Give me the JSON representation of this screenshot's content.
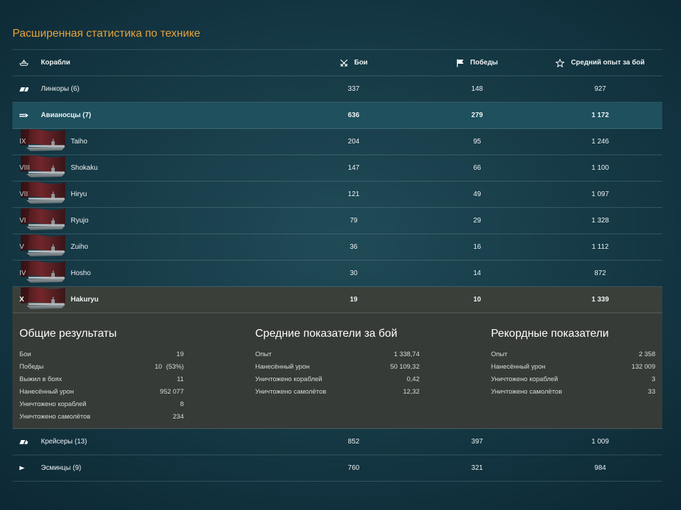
{
  "title": "Расширенная статистика по технике",
  "colors": {
    "title": "#e9a33b",
    "text": "#eef2f3",
    "expanded_class_row": "#1e505e",
    "selected_ship_row": "#3b3f3a",
    "details_panel": "#373b37"
  },
  "header": {
    "ships": {
      "label": "Корабли",
      "icon": "ship-icon"
    },
    "battles": {
      "label": "Бои",
      "icon": "crossed-swords-icon"
    },
    "wins": {
      "label": "Победы",
      "icon": "flag-icon"
    },
    "avg_xp": {
      "label": "Средний опыт за бой",
      "icon": "star-icon"
    }
  },
  "classes": [
    {
      "name": "Линкоры (6)",
      "icon": "battleship-icon",
      "battles": "337",
      "wins": "148",
      "avg_xp": "927"
    },
    {
      "name": "Авианосцы (7)",
      "icon": "aircraft-carrier-icon",
      "battles": "636",
      "wins": "279",
      "avg_xp": "1 172"
    },
    {
      "name": "Крейсеры (13)",
      "icon": "cruiser-icon",
      "battles": "852",
      "wins": "397",
      "avg_xp": "1 009"
    },
    {
      "name": "Эсминцы (9)",
      "icon": "destroyer-icon",
      "battles": "760",
      "wins": "321",
      "avg_xp": "984"
    }
  ],
  "carrier_ships": [
    {
      "tier": "IX",
      "name": "Taiho",
      "battles": "204",
      "wins": "95",
      "avg_xp": "1 246"
    },
    {
      "tier": "VIII",
      "name": "Shokaku",
      "battles": "147",
      "wins": "66",
      "avg_xp": "1 100"
    },
    {
      "tier": "VII",
      "name": "Hiryu",
      "battles": "121",
      "wins": "49",
      "avg_xp": "1 097"
    },
    {
      "tier": "VI",
      "name": "Ryujo",
      "battles": "79",
      "wins": "29",
      "avg_xp": "1 328"
    },
    {
      "tier": "V",
      "name": "Zuiho",
      "battles": "36",
      "wins": "16",
      "avg_xp": "1 112"
    },
    {
      "tier": "IV",
      "name": "Hosho",
      "battles": "30",
      "wins": "14",
      "avg_xp": "872"
    },
    {
      "tier": "X",
      "name": "Hakuryu",
      "battles": "19",
      "wins": "10",
      "avg_xp": "1 339"
    }
  ],
  "ship_details": {
    "general": {
      "title": "Общие результаты",
      "rows": [
        {
          "label": "Бои",
          "value": "19"
        },
        {
          "label": "Победы",
          "value": "10",
          "percent": "(53%)"
        },
        {
          "label": "Выжил в боях",
          "value": "11"
        },
        {
          "label": "Нанесённый урон",
          "value": "952 077"
        },
        {
          "label": "Уничтожено кораблей",
          "value": "8"
        },
        {
          "label": "Уничтожено самолётов",
          "value": "234"
        }
      ]
    },
    "averages": {
      "title": "Средние показатели за бой",
      "rows": [
        {
          "label": "Опыт",
          "value": "1 338,74"
        },
        {
          "label": "Нанесённый урон",
          "value": "50 109,32"
        },
        {
          "label": "Уничтожено кораблей",
          "value": "0,42"
        },
        {
          "label": "Уничтожено самолётов",
          "value": "12,32"
        }
      ]
    },
    "records": {
      "title": "Рекордные показатели",
      "rows": [
        {
          "label": "Опыт",
          "value": "2 358"
        },
        {
          "label": "Нанесённый урон",
          "value": "132 009"
        },
        {
          "label": "Уничтожено кораблей",
          "value": "3"
        },
        {
          "label": "Уничтожено самолётов",
          "value": "33"
        }
      ]
    }
  }
}
